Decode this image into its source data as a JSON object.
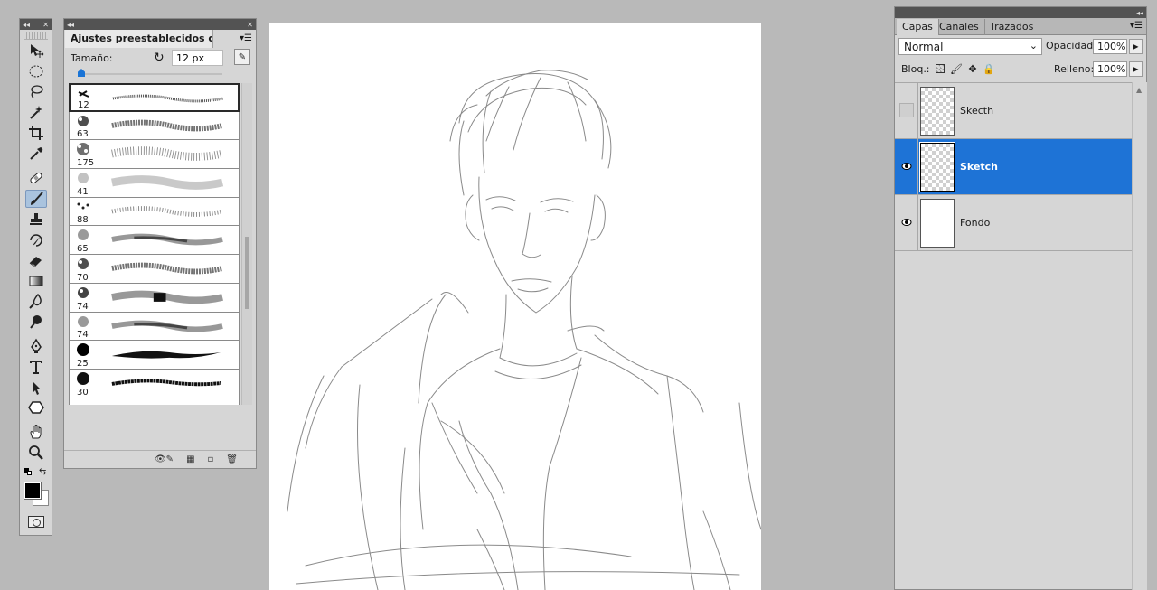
{
  "toolbox": {
    "collapse_glyph": "◂◂",
    "close_glyph": "✕",
    "tools": [
      {
        "name": "move-tool",
        "icon": "move-icon"
      },
      {
        "name": "marquee-tool",
        "icon": "ellipse-marquee-icon"
      },
      {
        "name": "lasso-tool",
        "icon": "lasso-icon"
      },
      {
        "name": "magic-wand-tool",
        "icon": "magic-wand-icon"
      },
      {
        "name": "crop-tool",
        "icon": "crop-icon"
      },
      {
        "name": "eyedropper-tool",
        "icon": "eyedropper-icon"
      },
      {
        "name": "healing-brush-tool",
        "icon": "bandage-icon"
      },
      {
        "name": "brush-tool",
        "icon": "brush-icon"
      },
      {
        "name": "clone-stamp-tool",
        "icon": "stamp-icon"
      },
      {
        "name": "history-brush-tool",
        "icon": "history-brush-icon"
      },
      {
        "name": "eraser-tool",
        "icon": "eraser-icon"
      },
      {
        "name": "gradient-tool",
        "icon": "gradient-icon"
      },
      {
        "name": "blur-tool",
        "icon": "droplet-icon"
      },
      {
        "name": "dodge-tool",
        "icon": "dodge-icon"
      },
      {
        "name": "pen-tool",
        "icon": "pen-icon"
      },
      {
        "name": "type-tool",
        "icon": "type-icon"
      },
      {
        "name": "path-selection-tool",
        "icon": "arrow-icon"
      },
      {
        "name": "shape-tool",
        "icon": "hexagon-icon"
      },
      {
        "name": "hand-tool",
        "icon": "hand-icon"
      },
      {
        "name": "zoom-tool",
        "icon": "zoom-icon"
      }
    ],
    "active_tool": "brush-tool",
    "foreground_color": "#000000",
    "background_color": "#ffffff"
  },
  "brush_panel": {
    "title": "Ajustes preestablecidos de ...",
    "size_label": "Tamaño:",
    "size_value": "12 px",
    "slider_fraction": 0.0,
    "brushes": [
      {
        "size": "12",
        "style": "fine"
      },
      {
        "size": "63",
        "style": "chalk"
      },
      {
        "size": "175",
        "style": "spatter"
      },
      {
        "size": "41",
        "style": "airbrush"
      },
      {
        "size": "88",
        "style": "dots"
      },
      {
        "size": "65",
        "style": "soft"
      },
      {
        "size": "70",
        "style": "chalk"
      },
      {
        "size": "74",
        "style": "wet"
      },
      {
        "size": "74",
        "style": "soft"
      },
      {
        "size": "25",
        "style": "hard"
      },
      {
        "size": "30",
        "style": "rough"
      },
      {
        "size": "",
        "style": "partial"
      }
    ],
    "selected_index": 0
  },
  "layers_panel": {
    "tabs": [
      "Capas",
      "Canales",
      "Trazados"
    ],
    "active_tab": "Capas",
    "blend_mode": "Normal",
    "opacity_label": "Opacidad:",
    "opacity_value": "100%",
    "lock_label": "Bloq.:",
    "fill_label": "Relleno:",
    "fill_value": "100%",
    "layers": [
      {
        "name": "Skecth",
        "visible": false,
        "selected": false,
        "thumb": "transparent"
      },
      {
        "name": "Sketch",
        "visible": true,
        "selected": true,
        "thumb": "transparent"
      },
      {
        "name": "Fondo",
        "visible": true,
        "selected": false,
        "thumb": "white"
      }
    ],
    "accent": "#1e73d6"
  },
  "canvas": {
    "background": "#ffffff",
    "content": "pencil-sketch"
  }
}
